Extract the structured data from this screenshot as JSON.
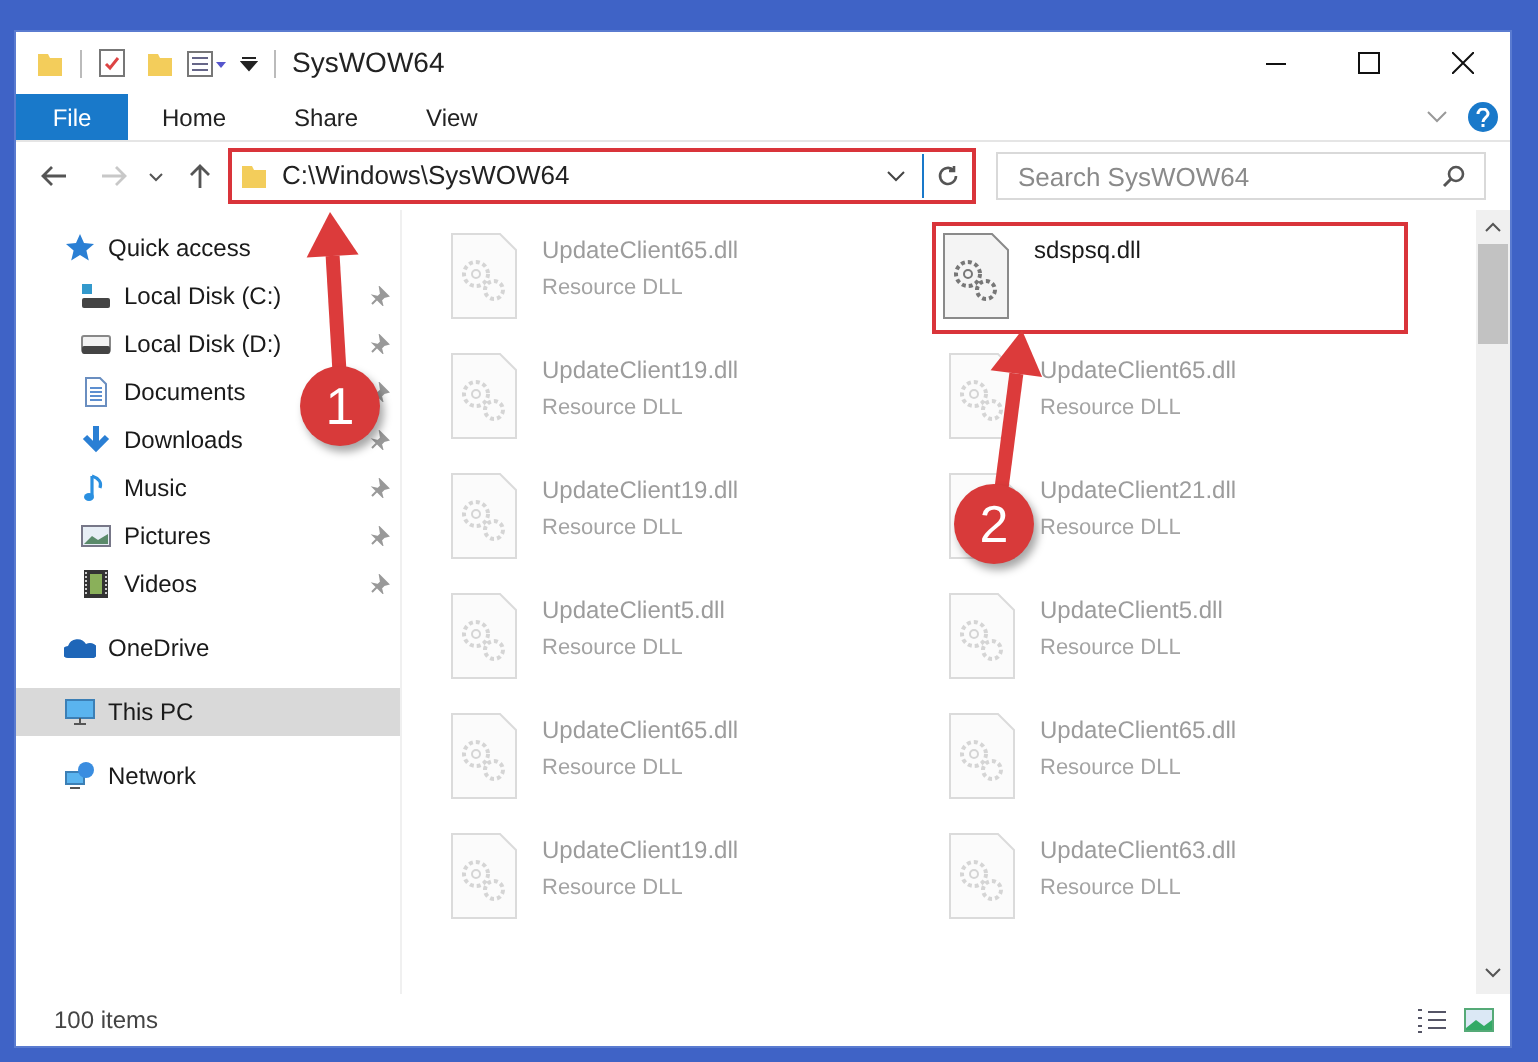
{
  "window": {
    "title": "SysWOW64"
  },
  "ribbon_tabs": [
    {
      "label": "File",
      "kind": "file"
    },
    {
      "label": "Home",
      "kind": "tab"
    },
    {
      "label": "Share",
      "kind": "tab"
    },
    {
      "label": "View",
      "kind": "tab"
    }
  ],
  "address_bar": {
    "path": "C:\\Windows\\SysWOW64",
    "highlighted": true
  },
  "search": {
    "placeholder": "Search SysWOW64"
  },
  "sidebar": {
    "items": [
      {
        "label": "Quick access",
        "selected": false,
        "children": [
          {
            "label": "Local Disk (C:)",
            "pinned": true,
            "selected": false
          },
          {
            "label": "Local Disk (D:)",
            "pinned": true,
            "selected": false
          },
          {
            "label": "Documents",
            "pinned": true,
            "selected": false
          },
          {
            "label": "Downloads",
            "pinned": true,
            "selected": false
          },
          {
            "label": "Music",
            "pinned": true,
            "selected": false
          },
          {
            "label": "Pictures",
            "pinned": true,
            "selected": false
          },
          {
            "label": "Videos",
            "pinned": true,
            "selected": false
          }
        ]
      },
      {
        "label": "OneDrive",
        "selected": false
      },
      {
        "label": "This PC",
        "selected": true
      },
      {
        "label": "Network",
        "selected": false
      }
    ]
  },
  "files": [
    {
      "name": "UpdateClient65.dll",
      "type": "Resource DLL",
      "faded": true,
      "highlighted": false
    },
    {
      "name": "sdspsq.dll",
      "faded": false,
      "highlighted": true
    },
    {
      "name": "UpdateClient19.dll",
      "type": "Resource DLL",
      "faded": true,
      "highlighted": false
    },
    {
      "name": "UpdateClient65.dll",
      "type": "Resource DLL",
      "faded": true,
      "highlighted": false
    },
    {
      "name": "UpdateClient19.dll",
      "type": "Resource DLL",
      "faded": true,
      "highlighted": false
    },
    {
      "name": "UpdateClient21.dll",
      "type": "Resource DLL",
      "faded": true,
      "highlighted": false
    },
    {
      "name": "UpdateClient5.dll",
      "type": "Resource DLL",
      "faded": true,
      "highlighted": false
    },
    {
      "name": "UpdateClient5.dll",
      "type": "Resource DLL",
      "faded": true,
      "highlighted": false
    },
    {
      "name": "UpdateClient65.dll",
      "type": "Resource DLL",
      "faded": true,
      "highlighted": false
    },
    {
      "name": "UpdateClient65.dll",
      "type": "Resource DLL",
      "faded": true,
      "highlighted": false
    },
    {
      "name": "UpdateClient19.dll",
      "type": "Resource DLL",
      "faded": true,
      "highlighted": false
    },
    {
      "name": "UpdateClient63.dll",
      "type": "Resource DLL",
      "faded": true,
      "highlighted": false
    }
  ],
  "status_bar": {
    "item_count": "100 items"
  },
  "annotations": [
    {
      "label": "1"
    },
    {
      "label": "2"
    }
  ]
}
